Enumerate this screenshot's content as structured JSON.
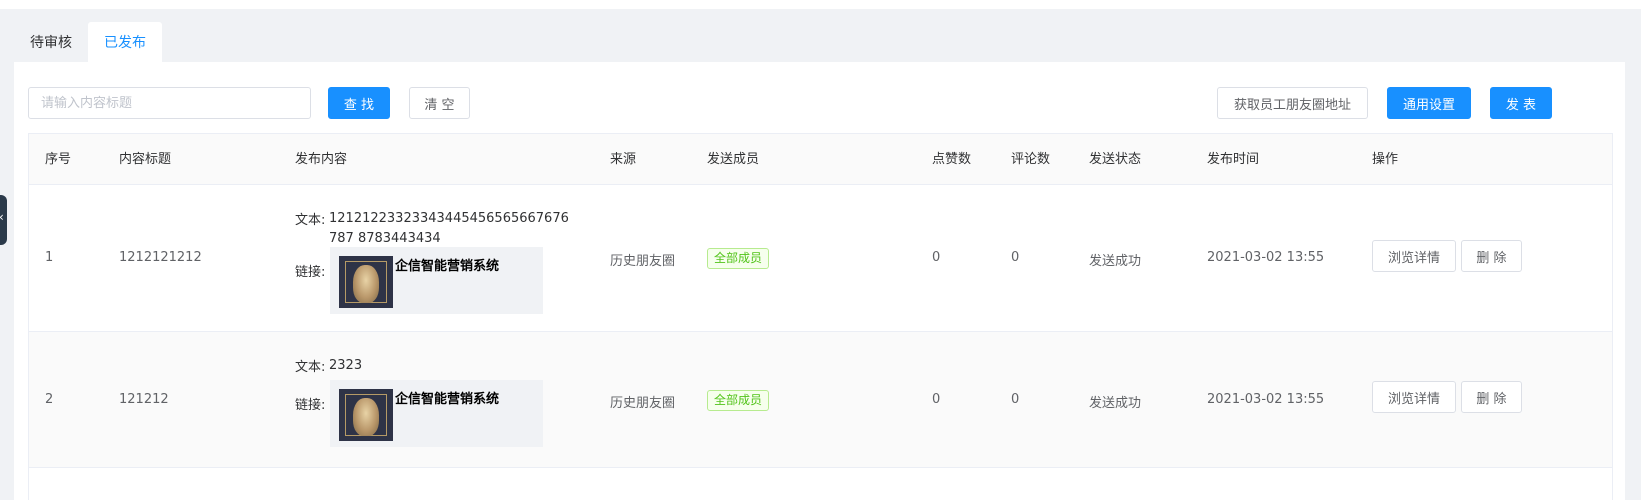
{
  "tabs": [
    {
      "label": "待审核",
      "active": false
    },
    {
      "label": "已发布",
      "active": true
    }
  ],
  "toolbar": {
    "search_placeholder": "请输入内容标题",
    "search_value": "",
    "find_label": "查 找",
    "clear_label": "清 空",
    "get_address_label": "获取员工朋友圈地址",
    "general_settings_label": "通用设置",
    "publish_label": "发 表"
  },
  "table": {
    "columns": [
      "序号",
      "内容标题",
      "发布内容",
      "来源",
      "发送成员",
      "点赞数",
      "评论数",
      "发送状态",
      "发布时间",
      "操作"
    ],
    "text_label": "文本:",
    "link_label": "链接:",
    "rows": [
      {
        "index": "1",
        "title": "1212121212",
        "text": "12121223323343445456565667676787 8783443434",
        "link_title": "企信智能营销系统",
        "source": "历史朋友圈",
        "members": "全部成员",
        "likes": "0",
        "comments": "0",
        "status": "发送成功",
        "time": "2021-03-02 13:55",
        "detail_label": "浏览详情",
        "delete_label": "删 除"
      },
      {
        "index": "2",
        "title": "121212",
        "text": "2323",
        "link_title": "企信智能营销系统",
        "source": "历史朋友圈",
        "members": "全部成员",
        "likes": "0",
        "comments": "0",
        "status": "发送成功",
        "time": "2021-03-02 13:55",
        "detail_label": "浏览详情",
        "delete_label": "删 除"
      }
    ]
  },
  "colors": {
    "primary": "#1890ff",
    "success_tag": "#52c41a",
    "page_bg": "#f0f2f5"
  }
}
